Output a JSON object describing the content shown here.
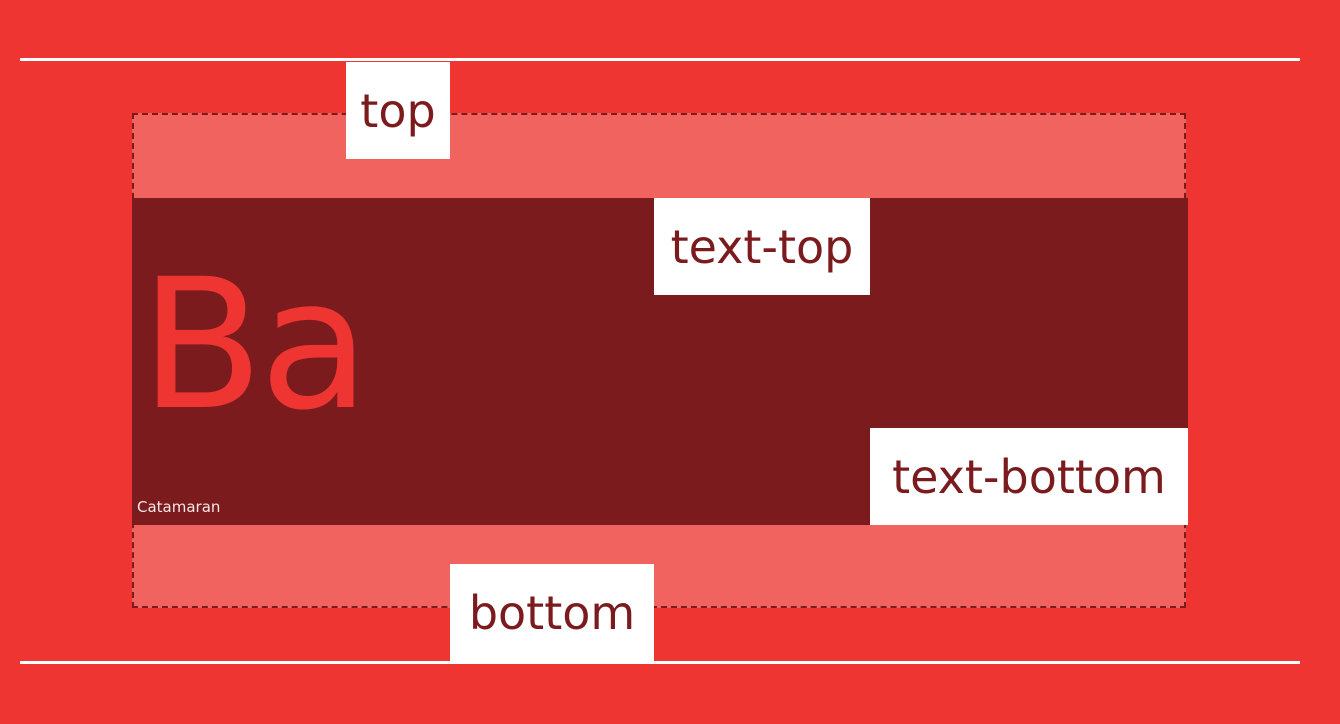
{
  "colors": {
    "background": "#ee3532",
    "outer_box_fill": "#f0635f",
    "inner_box_fill": "#7b1b1d",
    "label_bg": "#ffffff",
    "label_text": "#7b1b1d",
    "guide_lines": "#ffffff",
    "glyph_color": "#ee3532"
  },
  "labels": {
    "top": "top",
    "text_top": "text-top",
    "text_bottom": "text-bottom",
    "bottom": "bottom"
  },
  "specimen": {
    "glyphs": "Ba",
    "font_name": "Catamaran"
  }
}
